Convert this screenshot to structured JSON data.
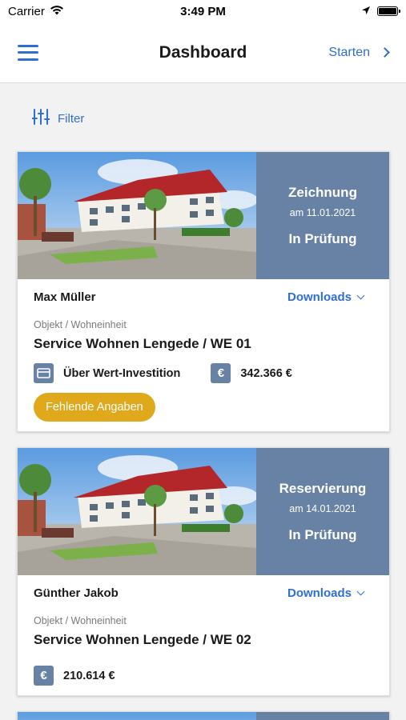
{
  "status_bar": {
    "carrier": "Carrier",
    "time": "3:49 PM"
  },
  "nav": {
    "title": "Dashboard",
    "action_label": "Starten"
  },
  "filter": {
    "label": "Filter"
  },
  "colors": {
    "accent": "#2f6fd0",
    "status_bg": "#6882a6",
    "warning": "#e0a81b"
  },
  "cards": [
    {
      "status_title": "Zeichnung",
      "status_date": "am 11.01.2021",
      "status_state": "In Prüfung",
      "person": "Max Müller",
      "downloads_label": "Downloads",
      "object_label": "Objekt / Wohneinheit",
      "object_title": "Service Wohnen Lengede / WE 01",
      "investment_type": "Über Wert-Investition",
      "amount": "342.366 €",
      "missing_button": "Fehlende Angaben"
    },
    {
      "status_title": "Reservierung",
      "status_date": "am 14.01.2021",
      "status_state": "In Prüfung",
      "person": "Günther Jakob",
      "downloads_label": "Downloads",
      "object_label": "Objekt / Wohneinheit",
      "object_title": "Service Wohnen Lengede / WE 02",
      "amount": "210.614 €"
    }
  ]
}
